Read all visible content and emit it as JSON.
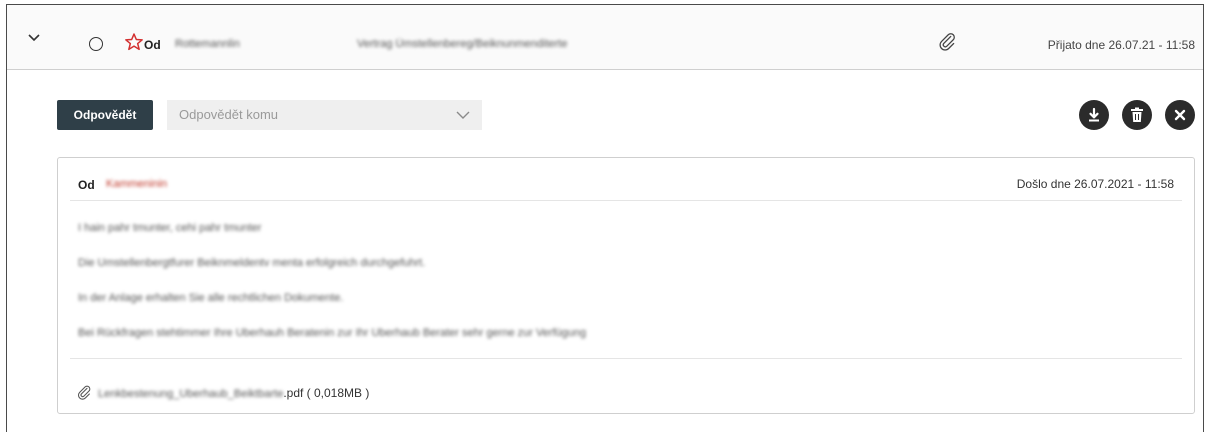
{
  "header": {
    "from_label": "Od",
    "sender": "Rottemannlin",
    "subject": "Vertrag Ümstellenbereg/Beiknunmenditerte",
    "received": "Přijato dne 26.07.21 - 11:58"
  },
  "toolbar": {
    "reply_label": "Odpovědět",
    "reply_to_placeholder": "Odpovědět komu"
  },
  "message": {
    "from_label": "Od",
    "sender": "Kammeninin",
    "received": "Došlo dne 26.07.2021 - 11:58",
    "body_lines": [
      "I hain pahr tmunter, cehi pahr tmunter",
      "Die Umstellenbergtfurer Beiknmeldentv menta erfolgreich durchgefuhrt.",
      "In der Anlage erhalten Sie alle rechtlichen Dokumente.",
      "Bei Rückfragen stehtimmer Ihre Uberhauh Beratenin zur Ihr Uberhaub Berater sehr gerne zur Verfügung"
    ],
    "attachment": {
      "name_prefix": "Lenkbestenung_Uberhaub_Beiktbarte",
      "extension": ".pdf",
      "size": " ( 0,018MB )"
    }
  },
  "icons": {
    "expand": "chevron-down-icon",
    "unread": "circle-icon",
    "flag": "star-icon",
    "attachment": "paperclip-icon",
    "download": "download-icon",
    "delete": "trash-icon",
    "close": "close-icon"
  },
  "colors": {
    "primary_button": "#2f3f48",
    "star": "#d32f2f",
    "sender": "#c0392b"
  }
}
